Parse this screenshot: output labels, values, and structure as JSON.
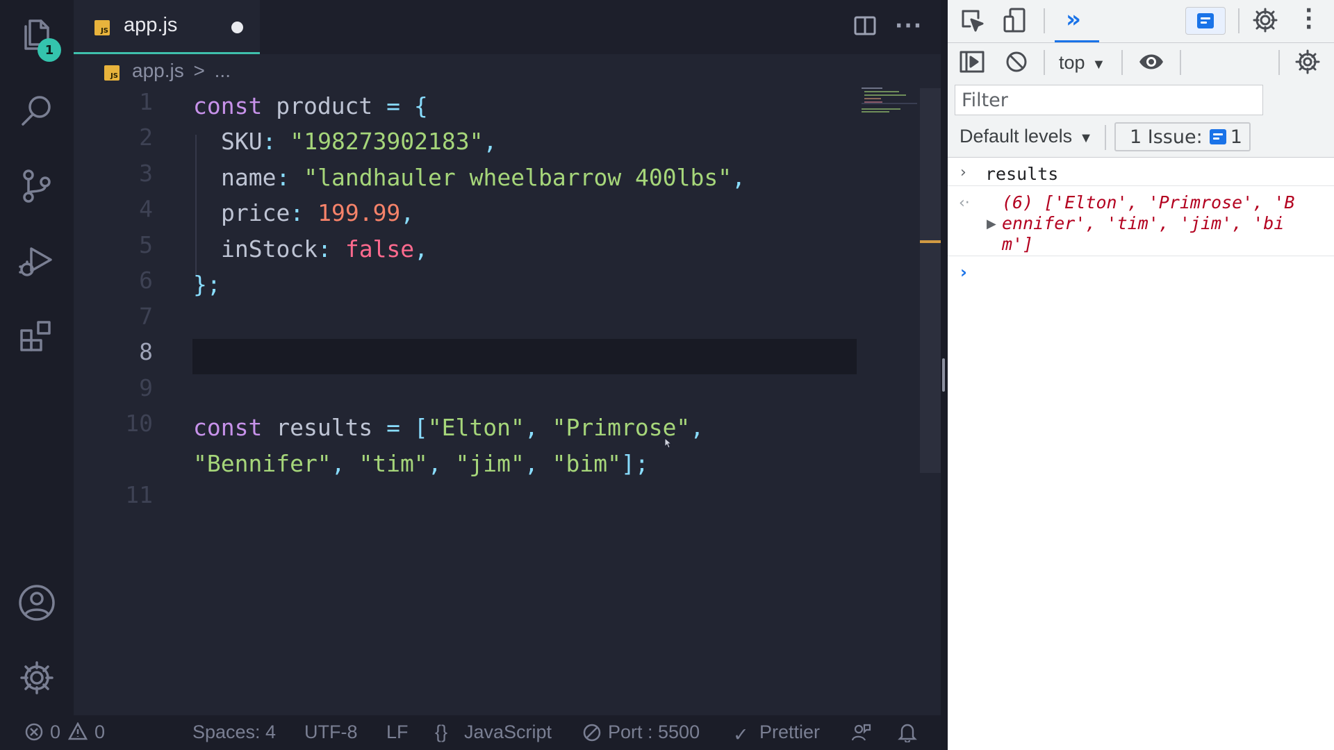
{
  "activity_bar": {
    "explorer_badge": "1"
  },
  "tab": {
    "icon_text": "JS",
    "label": "app.js"
  },
  "breadcrumb": {
    "file": "app.js",
    "separator": ">",
    "rest": "..."
  },
  "code": {
    "line_numbers": [
      "1",
      "2",
      "3",
      "4",
      "5",
      "6",
      "7",
      "8",
      "9",
      "10",
      "11"
    ],
    "l1": {
      "kw": "const",
      "name": "product",
      "eq": "=",
      "brace": "{"
    },
    "l2": {
      "key": "SKU",
      "colon": ":",
      "value": "\"198273902183\"",
      "comma": ","
    },
    "l3": {
      "key": "name",
      "colon": ":",
      "value": "\"landhauler wheelbarrow 400lbs\"",
      "comma": ","
    },
    "l4": {
      "key": "price",
      "colon": ":",
      "value": "199.99",
      "comma": ","
    },
    "l5": {
      "key": "inStock",
      "colon": ":",
      "value": "false",
      "comma": ","
    },
    "l6": {
      "close": "};"
    },
    "l10": {
      "kw": "const",
      "name": "results",
      "eq": "=",
      "open": "[",
      "v1": "\"Elton\"",
      "v2": "\"Primrose\"",
      "comma": ","
    },
    "l10b": {
      "v3": "\"Bennifer\"",
      "v4": "\"tim\"",
      "v5": "\"jim\"",
      "v6": "\"bim\"",
      "close": "];",
      "comma": ","
    }
  },
  "status_bar": {
    "errors": "0",
    "warnings": "0",
    "spaces": "Spaces: 4",
    "encoding": "UTF-8",
    "eol": "LF",
    "language_braces": "{}",
    "language": "JavaScript",
    "port": "Port : 5500",
    "prettier": "Prettier"
  },
  "devtools": {
    "more_tabs": "»",
    "context": "top",
    "filter_placeholder": "Filter",
    "levels": "Default levels",
    "issues_label": "1 Issue:",
    "issues_count": "1",
    "console": {
      "input": "results",
      "output_l1": "(6) ['Elton', 'Primrose', 'B",
      "output_l2": "ennifer', 'tim', 'jim', 'bi",
      "output_l3": "m']"
    }
  },
  "colors": {
    "accent": "#3fc0ac",
    "badge": "#34c4ad",
    "string": "#a6d67a",
    "number": "#f7836a",
    "boolean": "#ff6a8e",
    "keyword": "#c792ea",
    "console_value": "#b3001f",
    "link_blue": "#1a73e8"
  }
}
